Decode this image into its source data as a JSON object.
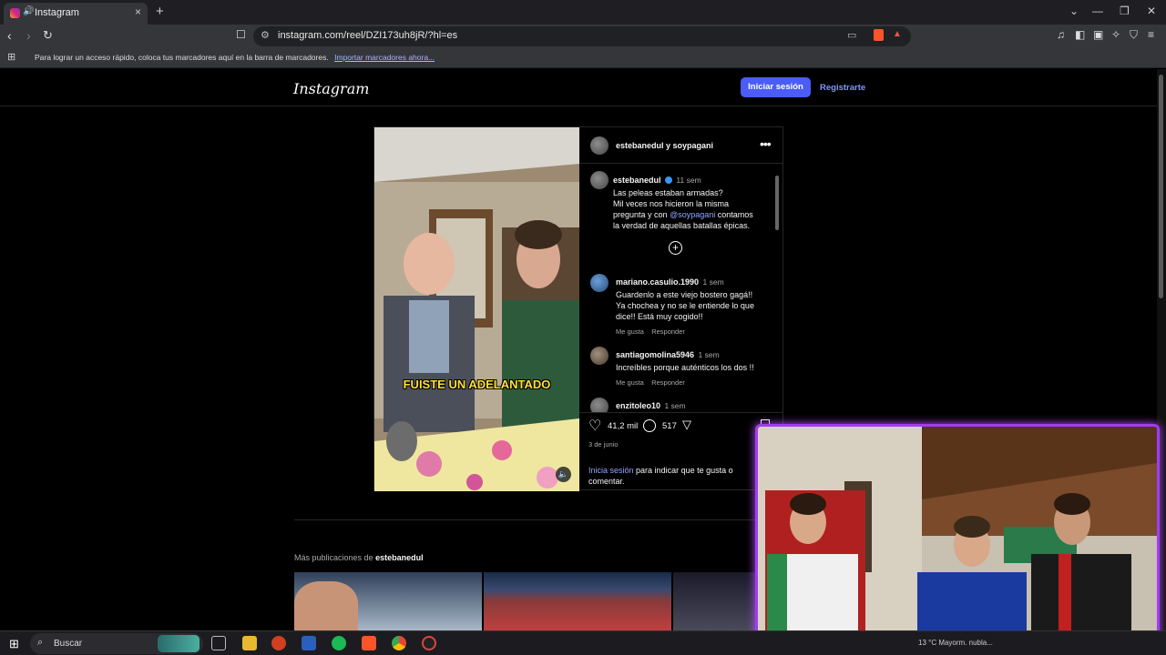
{
  "browser": {
    "tab_title": "Instagram",
    "tab_close": "×",
    "new_tab": "+",
    "url": "instagram.com/reel/DZI173uh8jR/?hl=es",
    "bookmarks_text": "Para lograr un acceso rápido, coloca tus marcadores aquí en la barra de marcadores.",
    "bookmarks_link": "Importar marcadores ahora..."
  },
  "header": {
    "logo": "Instagram",
    "login_label": "Iniciar sesión",
    "signup_label": "Registrarte"
  },
  "post": {
    "authors": "estebanedul y soypagani",
    "video_caption": "FUISTE UN ADELANTADO",
    "caption": {
      "user": "estebanedul",
      "time": "11 sem",
      "line1": "Las peleas estaban armadas?",
      "line2": "Mil veces nos hicieron la misma",
      "line3a": "pregunta y con",
      "mention": "@soypagani",
      "line3b": "contamos",
      "line4": "la verdad de aquellas batallas épicas."
    },
    "comments": [
      {
        "user": "mariano.casulio.1990",
        "time": "1 sem",
        "lines": [
          "Guardenlo a este viejo bostero gagá!!",
          "Ya chochea y no se le entiende lo que",
          "dice!! Está muy cogido!!"
        ],
        "like": "Me gusta",
        "reply": "Responder"
      },
      {
        "user": "santiagomolina5946",
        "time": "1 sem",
        "lines": [
          "Increíbles porque auténticos los dos !!"
        ],
        "like": "Me gusta",
        "reply": "Responder"
      },
      {
        "user": "enzitoleo10",
        "time": "1 sem"
      }
    ],
    "likes": "41,2 mil",
    "comment_count": "517",
    "date": "3 de junio",
    "login_prompt_link": "Inicia sesión",
    "login_prompt_rest": "para indicar que te gusta o",
    "login_prompt_rest2": "comentar."
  },
  "more": {
    "label": "Más publicaciones de",
    "user": "estebanedul"
  },
  "taskbar": {
    "search": "Buscar",
    "tray": "13 °C  Mayorm. nubla..."
  },
  "icons": [
    "instagram-icon",
    "speaker-icon",
    "back-icon",
    "forward-icon",
    "reload-icon",
    "bookmark-icon",
    "more-icon",
    "heart-icon",
    "comment-icon",
    "share-icon",
    "save-icon",
    "add-circle-icon",
    "mute-icon",
    "windows-icon",
    "search-icon"
  ],
  "colors": {
    "accent": "#4a5df9",
    "link": "#8fa6ff",
    "cam_border": "#a13cf0",
    "caption_yellow": "#ffe135"
  }
}
